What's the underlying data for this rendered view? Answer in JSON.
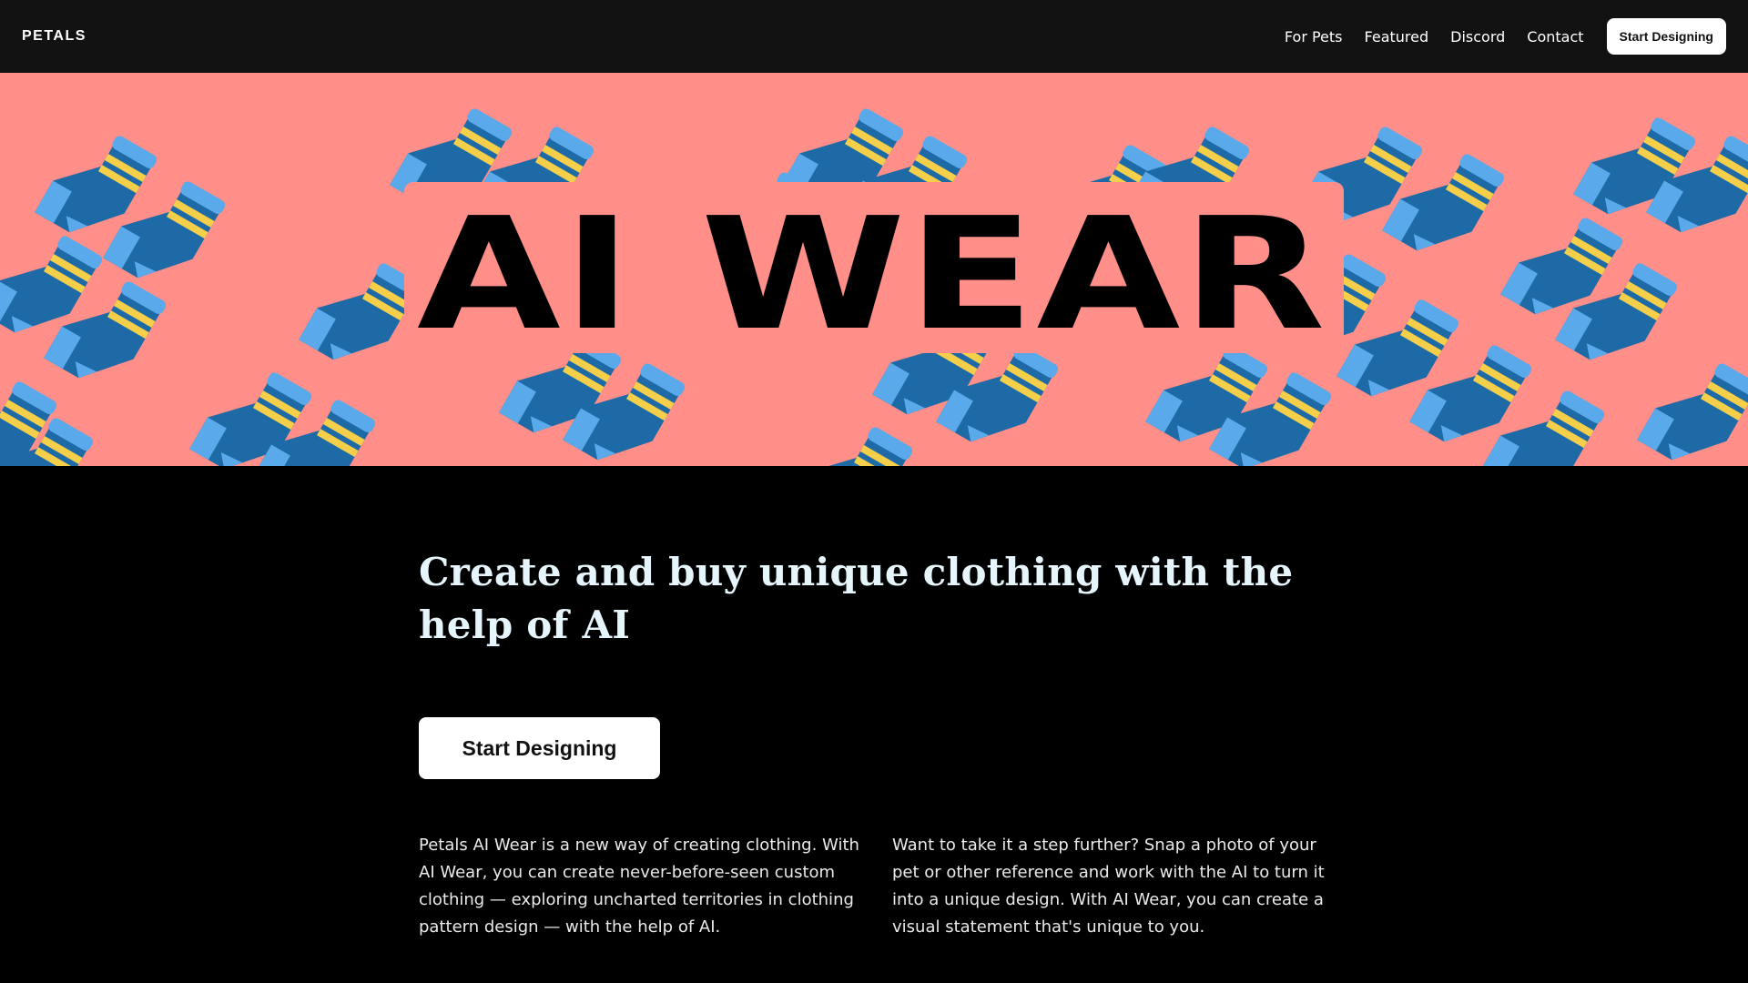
{
  "nav": {
    "brand": "PETALS",
    "links": [
      "For Pets",
      "Featured",
      "Discord",
      "Contact"
    ],
    "cta_label": "Start Designing"
  },
  "hero": {
    "title": "AI WEAR",
    "background_color": "#ff8f88",
    "sock_colors": {
      "body": "#1e6aa7",
      "toe": "#5aa9ea",
      "stripe": "#f5cf4a"
    }
  },
  "main": {
    "headline": "Create and buy unique clothing with the help of AI",
    "cta_label": "Start Designing",
    "paragraphs": [
      "Petals AI Wear is a new way of creating clothing. With AI Wear, you can create never-before-seen custom clothing — exploring uncharted territories in clothing pattern design — with the help of AI.",
      "Want to take it a step further? Snap a photo of your pet or other reference and work with the AI to turn it into a unique design. With AI Wear, you can create a visual statement that's unique to you."
    ]
  }
}
